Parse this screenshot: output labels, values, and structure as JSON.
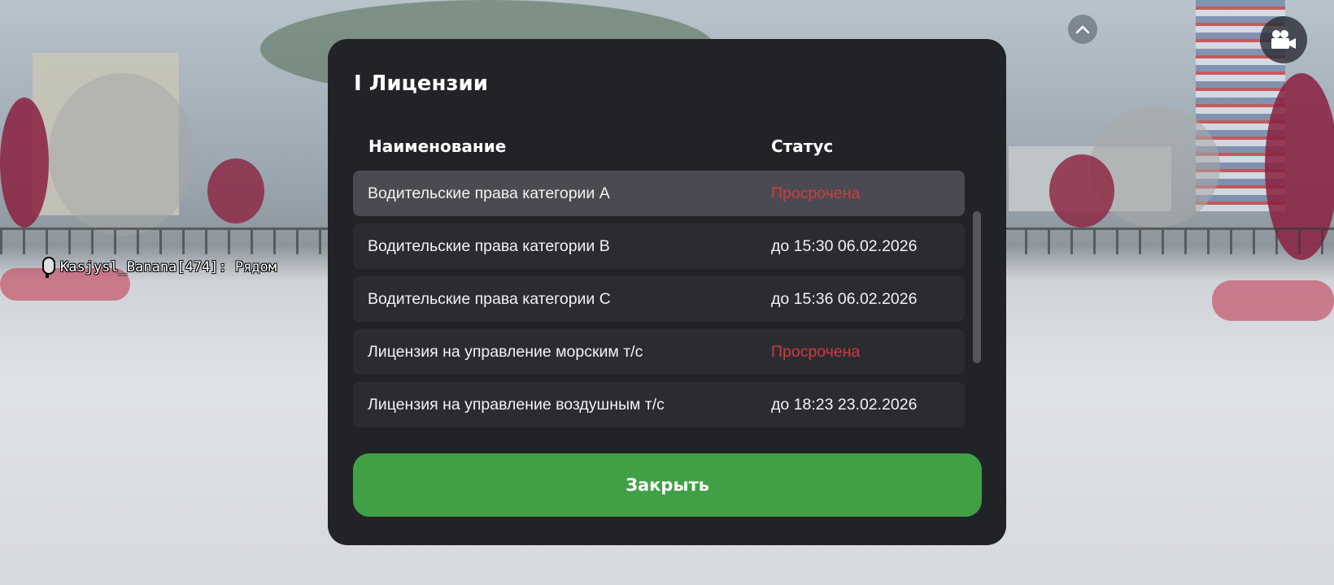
{
  "hud": {
    "player_tag": "Kasjysl_Banana[474]: Рядом",
    "icons": {
      "collapse": "chevron-up-icon",
      "camera": "video-camera-icon",
      "voice": "microphone-icon"
    }
  },
  "modal": {
    "title": "I Лицензии",
    "columns": {
      "name": "Наименование",
      "status": "Статус"
    },
    "rows": [
      {
        "name": "Водительские права категории A",
        "status": "Просрочена",
        "expired": true,
        "selected": true
      },
      {
        "name": "Водительские права категории B",
        "status": "до 15:30 06.02.2026",
        "expired": false,
        "selected": false
      },
      {
        "name": "Водительские права категории C",
        "status": "до 15:36 06.02.2026",
        "expired": false,
        "selected": false
      },
      {
        "name": "Лицензия на управление морским т/с",
        "status": "Просрочена",
        "expired": true,
        "selected": false
      },
      {
        "name": "Лицензия на управление воздушным т/с",
        "status": "до 18:23 23.02.2026",
        "expired": false,
        "selected": false
      }
    ],
    "close_label": "Закрыть"
  },
  "colors": {
    "panel": "#222328",
    "row": "#2b2c32",
    "row_selected": "#4a4b52",
    "expired": "#d23b3b",
    "button": "#41a045"
  }
}
